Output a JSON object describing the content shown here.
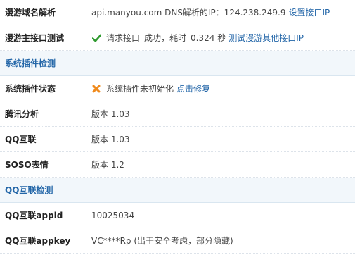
{
  "colors": {
    "link": "#2366a8",
    "section_bg": "#f2f7fb",
    "success": "#2e9a2e",
    "error": "#f08a1c"
  },
  "rows": {
    "domain": {
      "label": "漫游域名解析",
      "text": "api.manyou.com DNS解析的IP：124.238.249.9",
      "link": "设置接口IP"
    },
    "api_test": {
      "label": "漫游主接口测试",
      "status_icon": "check-icon",
      "text1": "请求接口",
      "text2": "成功，耗时",
      "text3": "0.324 秒",
      "link": "测试漫游其他接口IP"
    },
    "section1": {
      "title": "系统插件检测"
    },
    "plugin_status": {
      "label": "系统插件状态",
      "status_icon": "cross-icon",
      "text": "系统插件未初始化",
      "link": "点击修复"
    },
    "tencent": {
      "label": "腾讯分析",
      "value": "版本 1.03"
    },
    "qq_connect": {
      "label": "QQ互联",
      "value": "版本 1.03"
    },
    "soso": {
      "label": "SOSO表情",
      "value": "版本 1.2"
    },
    "section2": {
      "title": "QQ互联检测"
    },
    "appid": {
      "label": "QQ互联appid",
      "value": "10025034"
    },
    "appkey": {
      "label": "QQ互联appkey",
      "value": "VC****Rp (出于安全考虑，部分隐藏)"
    }
  }
}
